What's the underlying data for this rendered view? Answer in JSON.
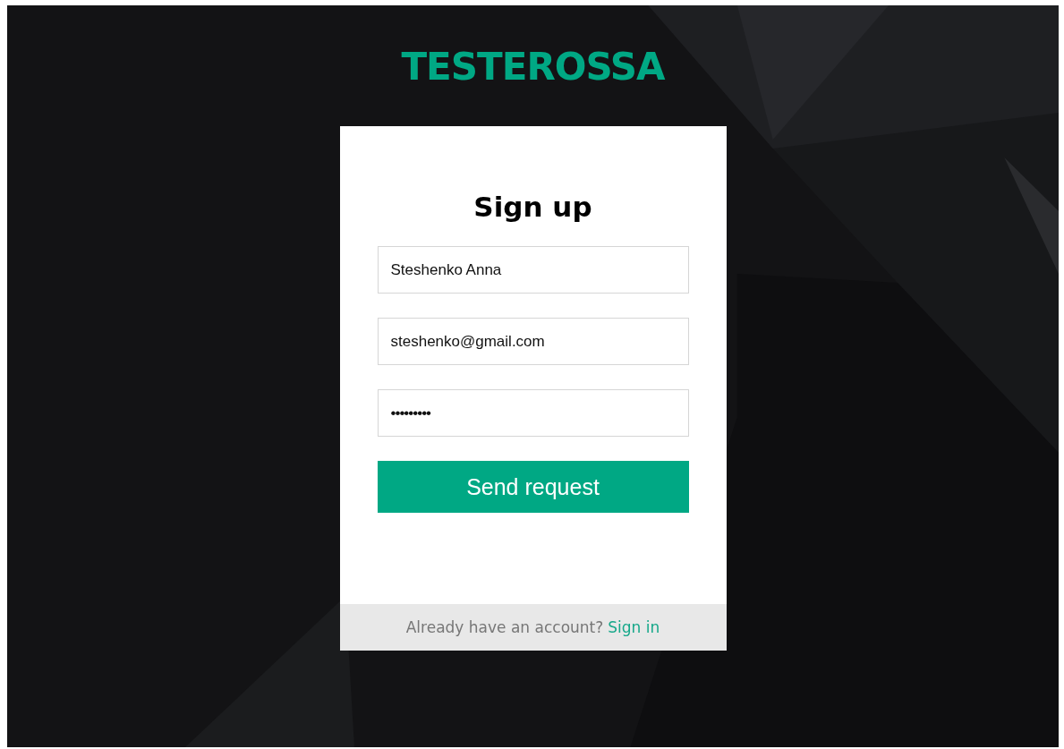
{
  "logo": "TESTEROSSA",
  "form": {
    "title": "Sign up",
    "fields": [
      {
        "kind": "text",
        "value": "Steshenko Anna"
      },
      {
        "kind": "email",
        "value": "steshenko@gmail.com"
      },
      {
        "kind": "password",
        "value": "•••••••••"
      }
    ],
    "submit": "Send request"
  },
  "footer": {
    "text": "Already have an account?",
    "link": "Sign in"
  }
}
